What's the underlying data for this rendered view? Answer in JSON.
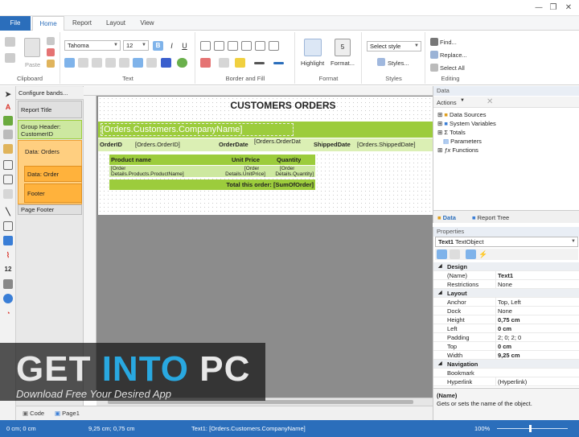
{
  "window": {
    "minimize": "—",
    "restore": "❐",
    "close": "✕"
  },
  "tabs": {
    "file": "File",
    "home": "Home",
    "report": "Report",
    "layout": "Layout",
    "view": "View"
  },
  "ribbon": {
    "clipboard": {
      "label": "Clipboard",
      "paste": "Paste"
    },
    "text": {
      "label": "Text",
      "font": "Tahoma",
      "size": "12",
      "bold": "B",
      "italic": "I",
      "underline": "U"
    },
    "border": {
      "label": "Border and Fill"
    },
    "format": {
      "label": "Format",
      "highlight": "Highlight",
      "format": "Format..."
    },
    "styles": {
      "label": "Styles",
      "select": "Select style",
      "styles": "Styles..."
    },
    "editing": {
      "label": "Editing",
      "find": "Find...",
      "replace": "Replace...",
      "select_all": "Select All"
    }
  },
  "bands": {
    "configure": "Configure bands...",
    "report_title": "Report Title",
    "group_header": "Group Header: CustomerID",
    "data_orders": "Data: Orders",
    "data_order": "Data: Order",
    "footer": "Footer",
    "page_footer": "Page Footer"
  },
  "report": {
    "title": "CUSTOMERS ORDERS",
    "company": "[Orders.Customers.CompanyName]",
    "orderid_label": "OrderID",
    "orderid_field": "[Orders.OrderID]",
    "orderdate_label": "OrderDate",
    "orderdate_field": "[Orders.OrderDat",
    "shipped_label": "ShippedDate",
    "shipped_field": "[Orders.ShippedDate]",
    "col_product": "Product name",
    "col_price": "Unit Price",
    "col_qty": "Quantity",
    "cell_product_1": "[Order",
    "cell_product_2": "Details.Products.ProductName]",
    "cell_price_1": "[Order",
    "cell_price_2": "Details.UnitPrice]",
    "cell_qty_1": "[Order",
    "cell_qty_2": "Details.Quantity]",
    "total": "Total this order: [SumOfOrder]"
  },
  "data_panel": {
    "header": "Data",
    "actions": "Actions",
    "items": [
      "Data Sources",
      "System Variables",
      "Totals",
      "Parameters",
      "Functions"
    ],
    "tab_data": "Data",
    "tab_tree": "Report Tree"
  },
  "properties": {
    "header": "Properties",
    "object_name": "Text1",
    "object_type": "TextObject",
    "rows": [
      {
        "cat": true,
        "name": "Design"
      },
      {
        "name": "(Name)",
        "value": "Text1",
        "bold": true
      },
      {
        "name": "Restrictions",
        "value": "None"
      },
      {
        "cat": true,
        "name": "Layout"
      },
      {
        "name": "Anchor",
        "value": "Top, Left"
      },
      {
        "name": "Dock",
        "value": "None"
      },
      {
        "name": "Height",
        "value": "0,75 cm",
        "bold": true
      },
      {
        "name": "Left",
        "value": "0 cm",
        "bold": true
      },
      {
        "name": "Padding",
        "value": "2; 0; 2; 0"
      },
      {
        "name": "Top",
        "value": "0 cm",
        "bold": true
      },
      {
        "name": "Width",
        "value": "9,25 cm",
        "bold": true
      },
      {
        "cat": true,
        "name": "Navigation"
      },
      {
        "name": "Bookmark",
        "value": ""
      },
      {
        "name": "Hyperlink",
        "value": "(Hyperlink)"
      }
    ],
    "desc_title": "(Name)",
    "desc_text": "Gets or sets the name of the object."
  },
  "bottom_tabs": {
    "code": "Code",
    "page1": "Page1"
  },
  "status": {
    "pos": "0 cm; 0 cm",
    "size": "9,25 cm; 0,75 cm",
    "object": "Text1:  [Orders.Customers.CompanyName]",
    "zoom": "100%"
  },
  "watermark": {
    "title_a": "GET ",
    "title_b": "INTO",
    "title_c": " PC",
    "sub": "Download Free Your Desired App"
  },
  "colors": {
    "accent": "#2b6ebb",
    "band_green": "#9ccc3c",
    "band_light": "#dbefb4",
    "band_orange": "#ffb23c"
  }
}
